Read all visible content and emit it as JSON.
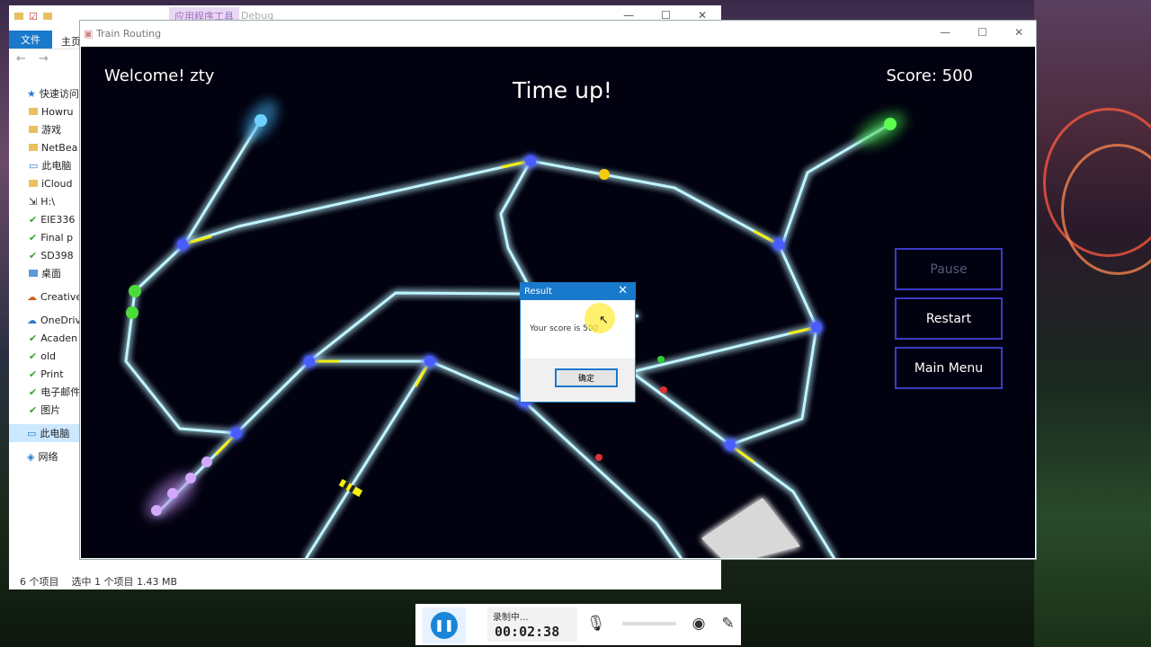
{
  "explorer": {
    "tool_tab": "应用程序工具",
    "path_label": "Debug",
    "ribbon_file": "文件",
    "ribbon_home": "主页",
    "quick_access": "快速访问",
    "items": [
      "Howru",
      "游戏",
      "NetBea",
      "此电脑",
      "iCloud",
      "H:\\",
      "EIE336",
      "Final p",
      "SD398",
      "桌面"
    ],
    "creative": "Creative",
    "onedrive": "OneDrive",
    "od_items": [
      "Acaden",
      "old",
      "Print",
      "电子邮件",
      "图片"
    ],
    "this_pc": "此电脑",
    "network": "网络",
    "status_count": "6 个项目",
    "status_selected": "选中 1 个项目  1.43 MB"
  },
  "game_window": {
    "title": "Train Routing",
    "welcome": "Welcome! zty",
    "time_up": "Time up!",
    "score": "Score: 500",
    "buttons": {
      "pause": "Pause",
      "restart": "Restart",
      "main_menu": "Main Menu"
    }
  },
  "dialog": {
    "title": "Result",
    "message": "Your score is 500",
    "ok": "确定"
  },
  "recorder": {
    "status": "录制中...",
    "elapsed": "00:02:38"
  },
  "colors": {
    "track": "#bff5ff",
    "glow": "#00d8ff",
    "switch": "#f5ef10",
    "node": "#4a5cff",
    "accent": "#1979ca"
  }
}
